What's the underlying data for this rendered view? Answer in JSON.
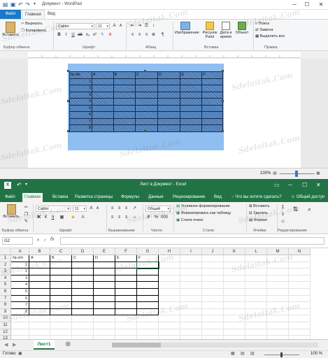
{
  "wordpad": {
    "title": "Документ - WordPad",
    "tabs": [
      "Файл",
      "Главная",
      "Вид"
    ],
    "clipboard": {
      "paste": "Вставить",
      "cut": "Вырезать",
      "copy": "Копировать",
      "label": "Буфер обмена"
    },
    "font": {
      "name": "Calibri",
      "size": "11",
      "label": "Шрифт"
    },
    "paragraph_label": "Абзац",
    "insert": {
      "picture": "Изображение",
      "paint": "Рисунок Paint",
      "datetime": "Дата и время",
      "object": "Объект",
      "label": "Вставка"
    },
    "editing": {
      "find": "Поиск",
      "replace": "Замена",
      "select_all": "Выделить все",
      "label": "Правка"
    },
    "table": {
      "header": [
        "№ п/п",
        "A",
        "B",
        "C",
        "D",
        "E",
        "F"
      ],
      "row_numbers": [
        "1",
        "2",
        "3",
        "4",
        "5",
        "6",
        "7",
        "8"
      ]
    },
    "zoom": "100%"
  },
  "excel": {
    "title": "Лист в Документ - Excel",
    "tabs": [
      "Файл",
      "Главная",
      "Вставка",
      "Разметка страницы",
      "Формулы",
      "Данные",
      "Рецензирование",
      "Вид",
      "Что вы хотите сделать?",
      "Общий доступ"
    ],
    "clipboard": {
      "paste": "Вставить",
      "label": "Буфер обмена"
    },
    "font": {
      "name": "Calibri",
      "size": "11",
      "label": "Шрифт"
    },
    "alignment_label": "Выравнивание",
    "number": {
      "format": "Общий",
      "label": "Число"
    },
    "styles": {
      "conditional": "Условное форматирование",
      "table": "Форматировать как таблицу",
      "cell": "Стили ячеек",
      "label": "Стили"
    },
    "cells": {
      "insert": "Вставить",
      "delete": "Удалить",
      "format": "Формат",
      "label": "Ячейки"
    },
    "editing_label": "Редактирование",
    "name_box": "G2",
    "fx": "fx",
    "columns": [
      "A",
      "B",
      "C",
      "D",
      "E",
      "F",
      "G",
      "H",
      "I",
      "J",
      "K",
      "L",
      "M",
      "N"
    ],
    "rows": [
      "1",
      "2",
      "3",
      "4",
      "5",
      "6",
      "7",
      "8",
      "9",
      "10",
      "11",
      "12",
      "13"
    ],
    "table_header": [
      "№ п/п",
      "A",
      "B",
      "C",
      "D",
      "E",
      "F"
    ],
    "row_numbers": [
      "1",
      "2",
      "3",
      "4",
      "5",
      "6",
      "7",
      "8"
    ],
    "sheet_tab": "Лист1",
    "status": "Готово",
    "zoom": "100 %"
  },
  "watermark": "Sdelaitak.Com"
}
